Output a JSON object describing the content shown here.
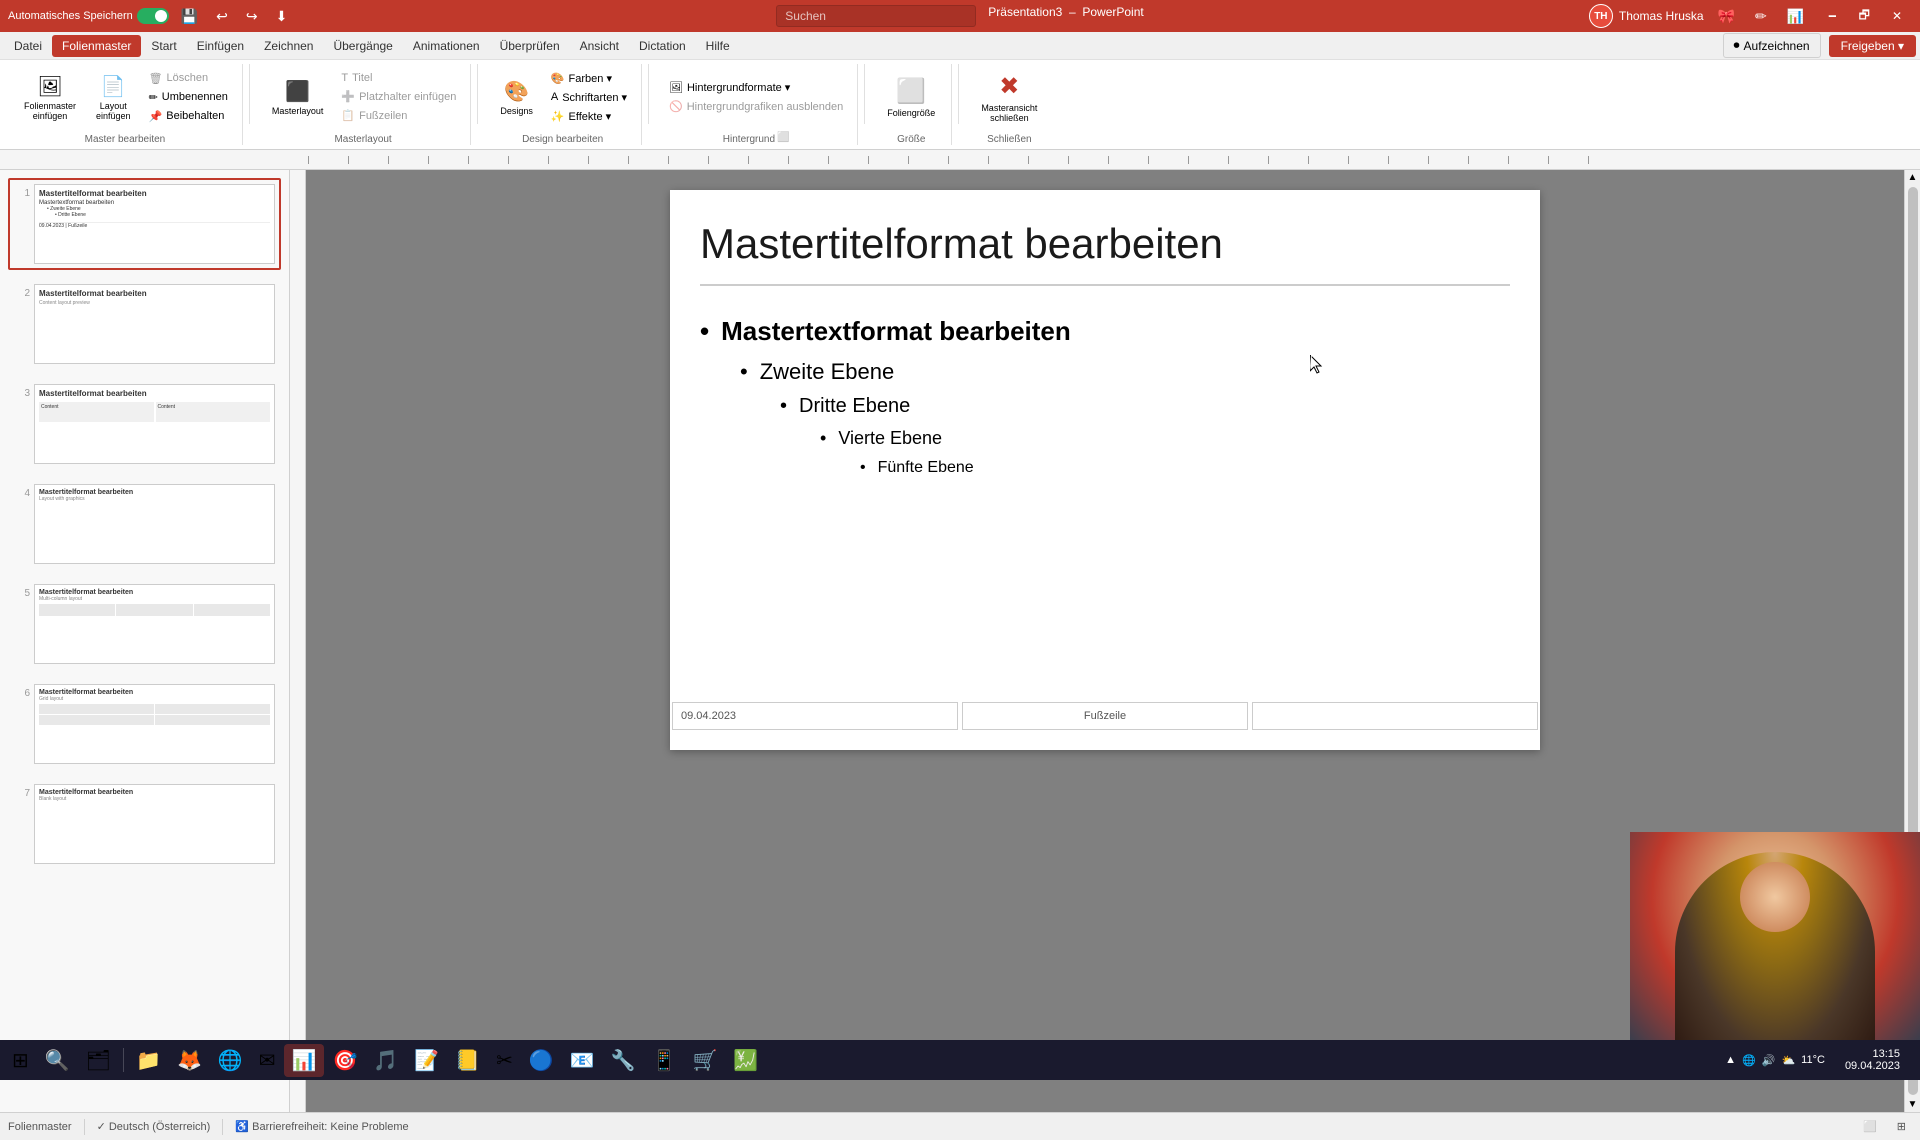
{
  "titlebar": {
    "autosave_label": "Automatisches Speichern",
    "file_name": "Präsentation3",
    "app_name": "PowerPoint",
    "user_name": "Thomas Hruska",
    "user_initials": "TH",
    "search_placeholder": "Suchen",
    "window_minimize": "🗕",
    "window_restore": "🗗",
    "window_close": "✕"
  },
  "menu": {
    "items": [
      {
        "label": "Datei",
        "active": false
      },
      {
        "label": "Folienmaster",
        "active": true
      },
      {
        "label": "Start",
        "active": false
      },
      {
        "label": "Einfügen",
        "active": false
      },
      {
        "label": "Zeichnen",
        "active": false
      },
      {
        "label": "Übergänge",
        "active": false
      },
      {
        "label": "Animationen",
        "active": false
      },
      {
        "label": "Überprüfen",
        "active": false
      },
      {
        "label": "Ansicht",
        "active": false
      },
      {
        "label": "Dictation",
        "active": false
      },
      {
        "label": "Hilfe",
        "active": false
      }
    ]
  },
  "ribbon_groups": [
    {
      "name": "Master bearbeiten",
      "buttons": [
        {
          "label": "Folienmaster einfügen",
          "icon": "🖼"
        },
        {
          "label": "Layout einfügen",
          "icon": "📄"
        },
        {
          "label": "Löschen",
          "icon": "🗑",
          "small": true,
          "disabled": true
        },
        {
          "label": "Umbenennen",
          "icon": "✏",
          "small": true
        },
        {
          "label": "Beibehalten",
          "icon": "📌",
          "small": true
        }
      ]
    },
    {
      "name": "Masterlayout",
      "buttons": [
        {
          "label": "Masterlayout",
          "icon": "⬛"
        },
        {
          "label": "Titel",
          "icon": "T",
          "small": true,
          "disabled": true
        },
        {
          "label": "Platzhalter einfügen",
          "icon": "➕",
          "small": true,
          "disabled": true
        },
        {
          "label": "Fußzeilen",
          "icon": "📋",
          "small": true,
          "disabled": true
        }
      ]
    },
    {
      "name": "Design bearbeiten",
      "buttons": [
        {
          "label": "Designs",
          "icon": "🎨"
        },
        {
          "label": "Farben",
          "icon": "🎨",
          "small": true
        },
        {
          "label": "Schriftarten",
          "icon": "A",
          "small": true
        },
        {
          "label": "Effekte",
          "icon": "✨",
          "small": true
        }
      ]
    },
    {
      "name": "Hintergrund",
      "buttons": [
        {
          "label": "Hintergrundformate",
          "icon": "🖼",
          "small": true
        },
        {
          "label": "Hintergrundgrafiken ausblenden",
          "icon": "🚫",
          "small": true,
          "disabled": true
        }
      ]
    },
    {
      "name": "Größe",
      "buttons": [
        {
          "label": "Foliengröße",
          "icon": "📐"
        }
      ]
    },
    {
      "name": "Schließen",
      "buttons": [
        {
          "label": "Masteransicht schließen",
          "icon": "✖"
        }
      ]
    }
  ],
  "right_ribbon": {
    "record_label": "Aufzeichnen",
    "share_label": "Freigeben"
  },
  "slide": {
    "title": "Mastertitelformat bearbeiten",
    "content": {
      "level1": "Mastertextformat bearbeiten",
      "level2": "Zweite Ebene",
      "level3": "Dritte Ebene",
      "level4": "Vierte Ebene",
      "level5": "Fünfte Ebene"
    },
    "footer_date": "09.04.2023",
    "footer_middle": "Fußzeile",
    "footer_right": ""
  },
  "slide_thumbnails": [
    {
      "number": "1",
      "title": "Mastertitelformat bearbeiten",
      "active": true
    },
    {
      "number": "2",
      "title": "Mastertitelformat bearbeiten"
    },
    {
      "number": "3",
      "title": "Mastertitelformat bearbeiten"
    },
    {
      "number": "4",
      "title": "Mastertitelformat bearbeiten"
    },
    {
      "number": "5",
      "title": "Mastertitelformat bearbeiten"
    },
    {
      "number": "6",
      "title": "Mastertitelformat bearbeiten"
    },
    {
      "number": "7",
      "title": "Mastertitelformat bearbeiten"
    }
  ],
  "statusbar": {
    "mode": "Folienmaster",
    "language": "Deutsch (Österreich)",
    "accessibility": "Barrierefreiheit: Keine Probleme"
  },
  "taskbar": {
    "start_icon": "⊞",
    "apps": [
      "📁",
      "🦊",
      "🌐",
      "✉",
      "📊",
      "🎯",
      "🎵",
      "📝",
      "📒",
      "✂",
      "🔵",
      "📧",
      "🔧",
      "📱",
      "🛒",
      "💹"
    ],
    "weather": "11°C",
    "time": "13:15",
    "date": "09.04.2023"
  }
}
